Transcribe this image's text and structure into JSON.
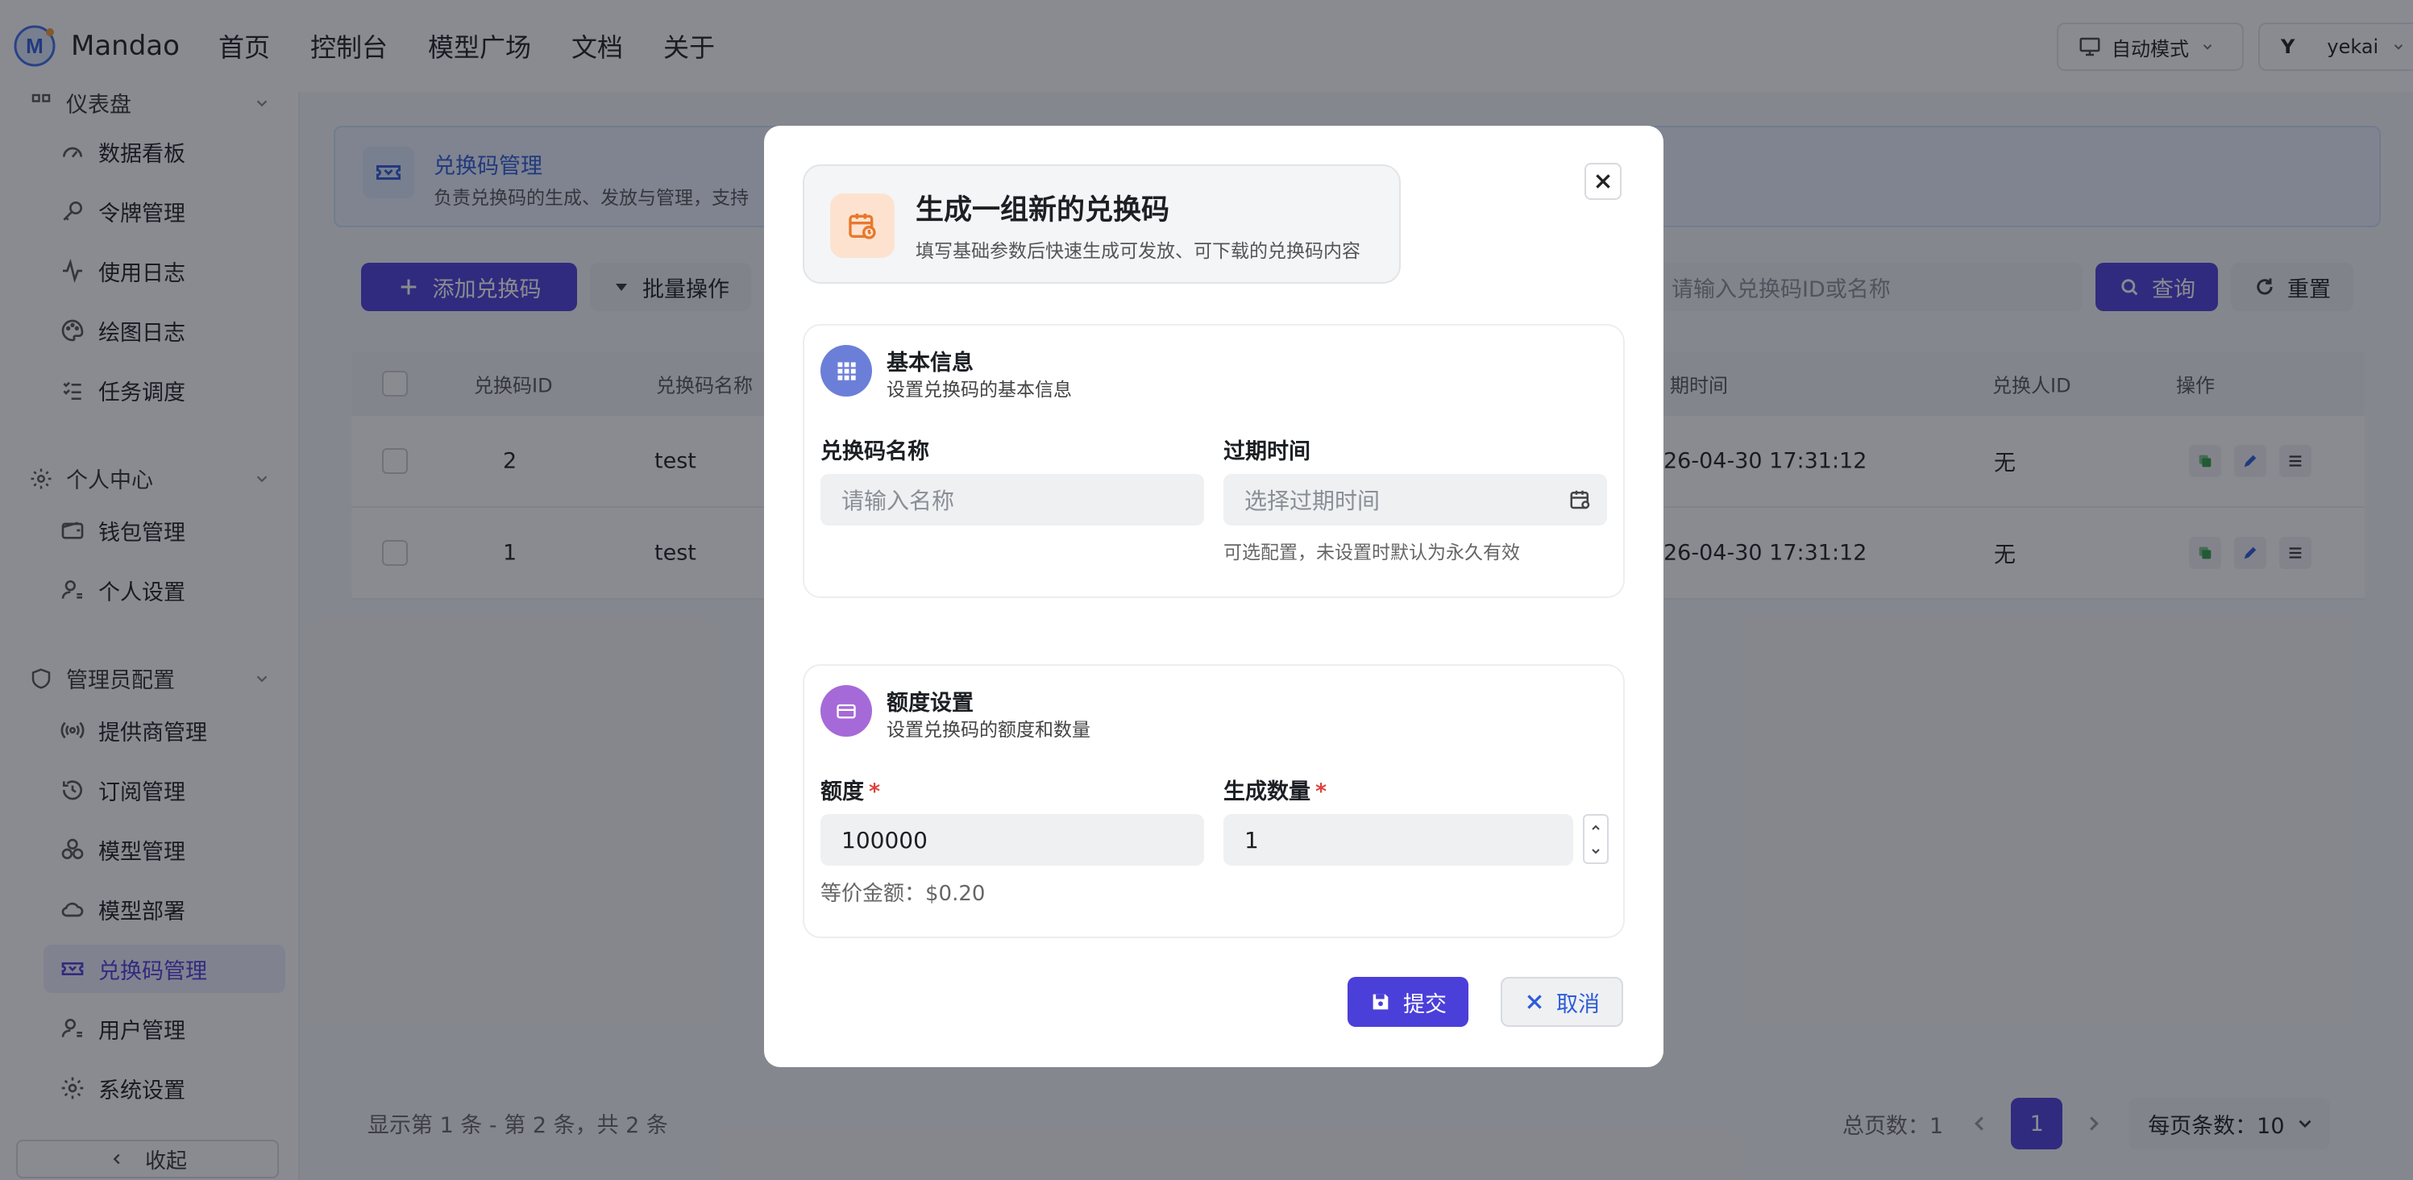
{
  "app": {
    "name": "Mandao",
    "nav": [
      "首页",
      "控制台",
      "模型广场",
      "文档",
      "关于"
    ],
    "mode_label": "自动模式",
    "user_avatar": "Y",
    "user_name": "yekai"
  },
  "sidebar": {
    "top_group_label": "仪表盘",
    "dashboard_items": [
      "数据看板",
      "令牌管理",
      "使用日志",
      "绘图日志",
      "任务调度"
    ],
    "personal_group_label": "个人中心",
    "personal_items": [
      "钱包管理",
      "个人设置"
    ],
    "admin_group_label": "管理员配置",
    "admin_items": [
      "提供商管理",
      "订阅管理",
      "模型管理",
      "模型部署",
      "兑换码管理",
      "用户管理",
      "系统设置"
    ],
    "active_item": "兑换码管理",
    "collapse_label": "收起"
  },
  "banner": {
    "title": "兑换码管理",
    "desc": "负责兑换码的生成、发放与管理，支持"
  },
  "toolbar": {
    "add_label": "添加兑换码",
    "batch_label": "批量操作",
    "search_placeholder": "请输入兑换码ID或名称",
    "query_label": "查询",
    "reset_label": "重置"
  },
  "table": {
    "headers": {
      "id": "兑换码ID",
      "name": "兑换码名称",
      "time": "期时间",
      "redeemer": "兑换人ID",
      "actions": "操作"
    },
    "rows": [
      {
        "id": "2",
        "name": "test",
        "time": "26-04-30 17:31:12",
        "redeemer": "无"
      },
      {
        "id": "1",
        "name": "test",
        "time": "26-04-30 17:31:12",
        "redeemer": "无"
      }
    ]
  },
  "footer": {
    "summary": "显示第 1 条 - 第 2 条，共 2 条",
    "total_pages": "总页数：1",
    "current_page": "1",
    "page_size": "每页条数：10"
  },
  "modal": {
    "title": "生成一组新的兑换码",
    "subtitle": "填写基础参数后快速生成可发放、可下载的兑换码内容",
    "basic": {
      "title": "基本信息",
      "subtitle": "设置兑换码的基本信息",
      "name_label": "兑换码名称",
      "name_placeholder": "请输入名称",
      "expire_label": "过期时间",
      "expire_placeholder": "选择过期时间",
      "expire_hint": "可选配置，未设置时默认为永久有效"
    },
    "quota": {
      "title": "额度设置",
      "subtitle": "设置兑换码的额度和数量",
      "amount_label": "额度",
      "amount_value": "100000",
      "count_label": "生成数量",
      "count_value": "1",
      "equivalent": "等价金额：$0.20"
    },
    "submit_label": "提交",
    "cancel_label": "取消"
  },
  "colors": {
    "primary": "#4b3fd9",
    "link": "#2d5bd8",
    "required": "#e0403a",
    "overlay": "rgba(22,24,35,0.5)"
  }
}
